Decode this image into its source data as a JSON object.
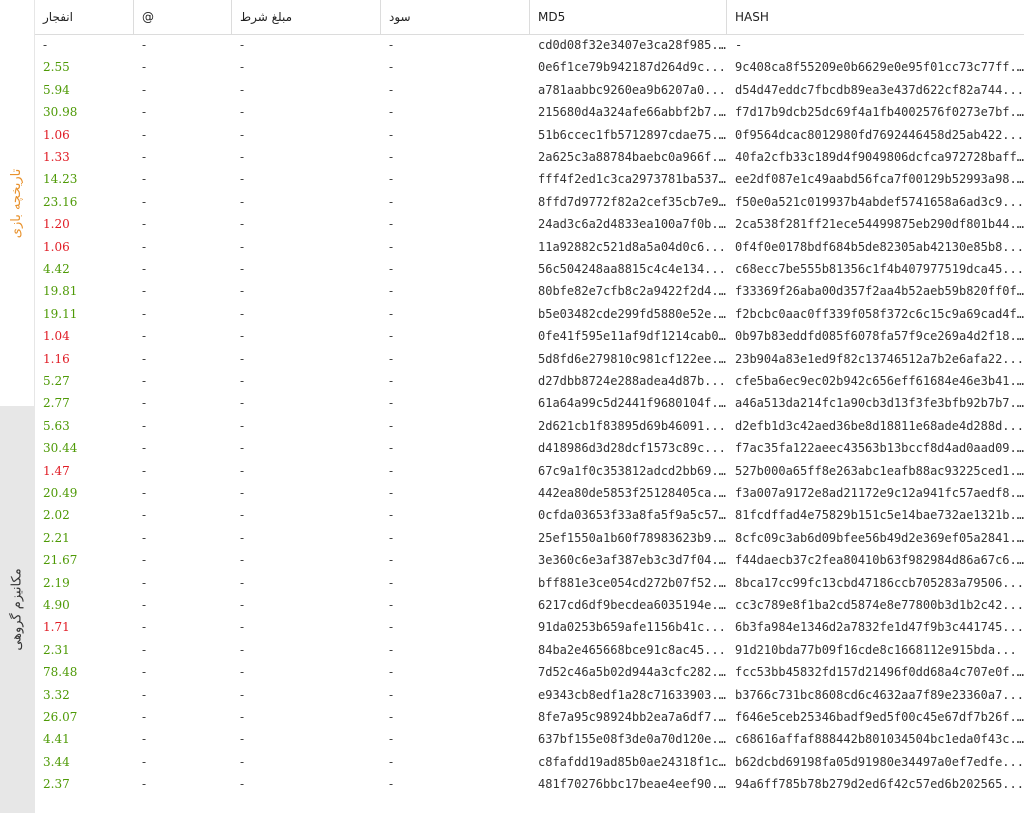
{
  "sidebar": {
    "tab_history": "تاریخچه بازی",
    "tab_group": "مکانیزم گروهی"
  },
  "colors": {
    "green": "#4e9a06",
    "red": "#e01b24",
    "accent_tab": "#e8922e"
  },
  "table": {
    "columns": [
      "انفجار",
      "@",
      "مبلغ شرط",
      "سود",
      "MD5",
      "HASH"
    ],
    "rows": [
      {
        "crash": "-",
        "at": "-",
        "bet": "-",
        "profit": "-",
        "md5": "cd0d08f32e3407e3ca28f985...",
        "hash": "-",
        "state": "neutral"
      },
      {
        "crash": "2.55",
        "at": "-",
        "bet": "-",
        "profit": "-",
        "md5": "0e6f1ce79b942187d264d9c...",
        "hash": "9c408ca8f55209e0b6629e0e95f01cc73c77ff...",
        "state": "win"
      },
      {
        "crash": "5.94",
        "at": "-",
        "bet": "-",
        "profit": "-",
        "md5": "a781aabbc9260ea9b6207a0...",
        "hash": "d54d47eddc7fbcdb89ea3e437d622cf82a744...",
        "state": "win"
      },
      {
        "crash": "30.98",
        "at": "-",
        "bet": "-",
        "profit": "-",
        "md5": "215680d4a324afe66abbf2b7...",
        "hash": "f7d17b9dcb25dc69f4a1fb4002576f0273e7bf...",
        "state": "win"
      },
      {
        "crash": "1.06",
        "at": "-",
        "bet": "-",
        "profit": "-",
        "md5": "51b6ccec1fb5712897cdae75...",
        "hash": "0f9564dcac8012980fd7692446458d25ab422...",
        "state": "loss"
      },
      {
        "crash": "1.33",
        "at": "-",
        "bet": "-",
        "profit": "-",
        "md5": "2a625c3a88784baebc0a966f...",
        "hash": "40fa2cfb33c189d4f9049806dcfca972728baff...",
        "state": "loss"
      },
      {
        "crash": "14.23",
        "at": "-",
        "bet": "-",
        "profit": "-",
        "md5": "fff4f2ed1c3ca2973781ba537...",
        "hash": "ee2df087e1c49aabd56fca7f00129b52993a98...",
        "state": "win"
      },
      {
        "crash": "23.16",
        "at": "-",
        "bet": "-",
        "profit": "-",
        "md5": "8ffd7d9772f82a2cef35cb7e9...",
        "hash": "f50e0a521c019937b4abdef5741658a6ad3c9...",
        "state": "win"
      },
      {
        "crash": "1.20",
        "at": "-",
        "bet": "-",
        "profit": "-",
        "md5": "24ad3c6a2d4833ea100a7f0b...",
        "hash": "2ca538f281ff21ece54499875eb290df801b44...",
        "state": "loss"
      },
      {
        "crash": "1.06",
        "at": "-",
        "bet": "-",
        "profit": "-",
        "md5": "11a92882c521d8a5a04d0c6...",
        "hash": "0f4f0e0178bdf684b5de82305ab42130e85b8...",
        "state": "loss"
      },
      {
        "crash": "4.42",
        "at": "-",
        "bet": "-",
        "profit": "-",
        "md5": "56c504248aa8815c4c4e134...",
        "hash": "c68ecc7be555b81356c1f4b407977519dca45...",
        "state": "win"
      },
      {
        "crash": "19.81",
        "at": "-",
        "bet": "-",
        "profit": "-",
        "md5": "80bfe82e7cfb8c2a9422f2d4...",
        "hash": "f33369f26aba00d357f2aa4b52aeb59b820ff0f...",
        "state": "win"
      },
      {
        "crash": "19.11",
        "at": "-",
        "bet": "-",
        "profit": "-",
        "md5": "b5e03482cde299fd5880e52e...",
        "hash": "f2bcbc0aac0ff339f058f372c6c15c9a69cad4f...",
        "state": "win"
      },
      {
        "crash": "1.04",
        "at": "-",
        "bet": "-",
        "profit": "-",
        "md5": "0fe41f595e11af9df1214cab0...",
        "hash": "0b97b83eddfd085f6078fa57f9ce269a4d2f18...",
        "state": "loss"
      },
      {
        "crash": "1.16",
        "at": "-",
        "bet": "-",
        "profit": "-",
        "md5": "5d8fd6e279810c981cf122ee...",
        "hash": "23b904a83e1ed9f82c13746512a7b2e6afa22...",
        "state": "loss"
      },
      {
        "crash": "5.27",
        "at": "-",
        "bet": "-",
        "profit": "-",
        "md5": "d27dbb8724e288adea4d87b...",
        "hash": "cfe5ba6ec9ec02b942c656eff61684e46e3b41...",
        "state": "win"
      },
      {
        "crash": "2.77",
        "at": "-",
        "bet": "-",
        "profit": "-",
        "md5": "61a64a99c5d2441f9680104f...",
        "hash": "a46a513da214fc1a90cb3d13f3fe3bfb92b7b7...",
        "state": "win"
      },
      {
        "crash": "5.63",
        "at": "-",
        "bet": "-",
        "profit": "-",
        "md5": "2d621cb1f83895d69b46091...",
        "hash": "d2efb1d3c42aed36be8d18811e68ade4d288d...",
        "state": "win"
      },
      {
        "crash": "30.44",
        "at": "-",
        "bet": "-",
        "profit": "-",
        "md5": "d418986d3d28dcf1573c89c...",
        "hash": "f7ac35fa122aeec43563b13bccf8d4ad0aad09...",
        "state": "win"
      },
      {
        "crash": "1.47",
        "at": "-",
        "bet": "-",
        "profit": "-",
        "md5": "67c9a1f0c353812adcd2bb69...",
        "hash": "527b000a65ff8e263abc1eafb88ac93225ced1...",
        "state": "loss"
      },
      {
        "crash": "20.49",
        "at": "-",
        "bet": "-",
        "profit": "-",
        "md5": "442ea80de5853f25128405ca...",
        "hash": "f3a007a9172e8ad21172e9c12a941fc57aedf8...",
        "state": "win"
      },
      {
        "crash": "2.02",
        "at": "-",
        "bet": "-",
        "profit": "-",
        "md5": "0cfda03653f33a8fa5f9a5c57...",
        "hash": "81fcdffad4e75829b151c5e14bae732ae1321b...",
        "state": "win"
      },
      {
        "crash": "2.21",
        "at": "-",
        "bet": "-",
        "profit": "-",
        "md5": "25ef1550a1b60f78983623b9...",
        "hash": "8cfc09c3ab6d09bfee56b49d2e369ef05a2841...",
        "state": "win"
      },
      {
        "crash": "21.67",
        "at": "-",
        "bet": "-",
        "profit": "-",
        "md5": "3e360c6e3af387eb3c3d7f04...",
        "hash": "f44daecb37c2fea80410b63f982984d86a67c6...",
        "state": "win"
      },
      {
        "crash": "2.19",
        "at": "-",
        "bet": "-",
        "profit": "-",
        "md5": "bff881e3ce054cd272b07f52...",
        "hash": "8bca17cc99fc13cbd47186ccb705283a79506...",
        "state": "win"
      },
      {
        "crash": "4.90",
        "at": "-",
        "bet": "-",
        "profit": "-",
        "md5": "6217cd6df9becdea6035194e...",
        "hash": "cc3c789e8f1ba2cd5874e8e77800b3d1b2c42...",
        "state": "win"
      },
      {
        "crash": "1.71",
        "at": "-",
        "bet": "-",
        "profit": "-",
        "md5": "91da0253b659afe1156b41c...",
        "hash": "6b3fa984e1346d2a7832fe1d47f9b3c441745...",
        "state": "loss"
      },
      {
        "crash": "2.31",
        "at": "-",
        "bet": "-",
        "profit": "-",
        "md5": "84ba2e465668bce91c8ac45...",
        "hash": "91d210bda77b09f16cde8c1668112e915bda...",
        "state": "win"
      },
      {
        "crash": "78.48",
        "at": "-",
        "bet": "-",
        "profit": "-",
        "md5": "7d52c46a5b02d944a3cfc282...",
        "hash": "fcc53bb45832fd157d21496f0dd68a4c707e0f...",
        "state": "win"
      },
      {
        "crash": "3.32",
        "at": "-",
        "bet": "-",
        "profit": "-",
        "md5": "e9343cb8edf1a28c71633903...",
        "hash": "b3766c731bc8608cd6c4632aa7f89e23360a7...",
        "state": "win"
      },
      {
        "crash": "26.07",
        "at": "-",
        "bet": "-",
        "profit": "-",
        "md5": "8fe7a95c98924bb2ea7a6df7...",
        "hash": "f646e5ceb25346badf9ed5f00c45e67df7b26f...",
        "state": "win"
      },
      {
        "crash": "4.41",
        "at": "-",
        "bet": "-",
        "profit": "-",
        "md5": "637bf155e08f3de0a70d120e...",
        "hash": "c68616affaf888442b801034504bc1eda0f43c...",
        "state": "win"
      },
      {
        "crash": "3.44",
        "at": "-",
        "bet": "-",
        "profit": "-",
        "md5": "c8fafdd19ad85b0ae24318f1c...",
        "hash": "b62dcbd69198fa05d91980e34497a0ef7edfe...",
        "state": "win"
      },
      {
        "crash": "2.37",
        "at": "-",
        "bet": "-",
        "profit": "-",
        "md5": "481f70276bbc17beae4eef90...",
        "hash": "94a6ff785b78b279d2ed6f42c57ed6b202565...",
        "state": "win"
      }
    ]
  }
}
